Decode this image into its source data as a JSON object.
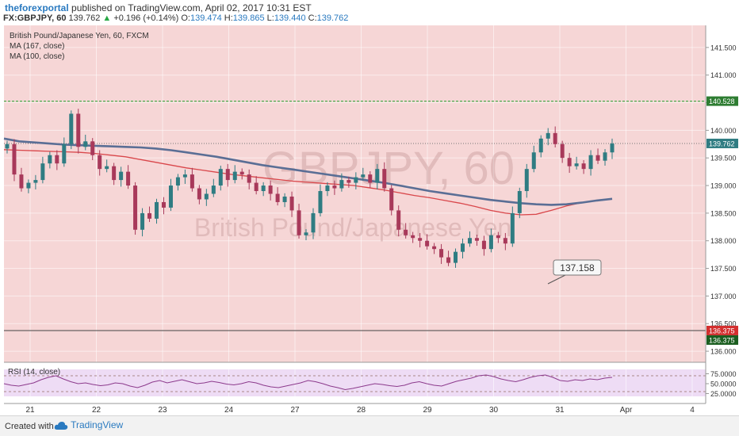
{
  "header": {
    "author": "theforexportal",
    "published": "published on TradingView.com, April 02, 2017 10:31 EST",
    "symbol": "FX:GBPJPY, 60",
    "last": "139.762",
    "change": "+0.196 (+0.14%)",
    "o_label": "O:",
    "o_val": "139.474",
    "h_label": "H:",
    "h_val": "139.865",
    "l_label": "L:",
    "l_val": "139.440",
    "c_label": "C:",
    "c_val": "139.762"
  },
  "legend": {
    "title": "British Pound/Japanese Yen, 60, FXCM",
    "ma1": "MA (167, close)",
    "ma2": "MA (100, close)"
  },
  "watermark": {
    "symbol": "GBPJPY, 60",
    "name": "British Pound/Japanese Yen"
  },
  "callout": "137.158",
  "footer": {
    "created": "Created with",
    "brand": "TradingView"
  },
  "colors": {
    "panel_bg": "#f6d6d6",
    "up_candle": "#2f7c82",
    "down_candle": "#a8395a",
    "ma167": "#5a6e95",
    "ma100": "#d9474b",
    "level_line": "#4caf50",
    "rsi_line": "#8c3a8c",
    "rsi_band": "#eedcf5"
  },
  "chart_data": {
    "type": "candlestick",
    "title": "British Pound/Japanese Yen, 60, FXCM",
    "y_axis": {
      "ticks": [
        "141.500",
        "141.000",
        "140.500",
        "140.000",
        "139.500",
        "139.000",
        "138.500",
        "138.000",
        "137.500",
        "137.000",
        "136.500",
        "136.000"
      ],
      "range": [
        135.8,
        141.9
      ]
    },
    "x_axis": {
      "ticks": [
        "21",
        "22",
        "23",
        "24",
        "27",
        "28",
        "29",
        "30",
        "31",
        "Apr",
        "4"
      ]
    },
    "price_labels": [
      "140.528",
      "139.762",
      "136.375",
      "136.375"
    ],
    "levels": {
      "resistance": 140.528,
      "last_price": 139.762,
      "support": 136.375
    },
    "annotation": {
      "text": "137.158",
      "value": 137.158
    },
    "closes": [
      139.75,
      139.2,
      138.95,
      139.05,
      139.1,
      139.4,
      139.55,
      139.4,
      139.75,
      140.3,
      139.7,
      139.8,
      139.55,
      139.3,
      139.35,
      139.1,
      139.25,
      139.0,
      138.2,
      138.5,
      138.4,
      138.7,
      138.6,
      139.0,
      139.15,
      139.2,
      138.95,
      138.75,
      138.85,
      139.0,
      139.3,
      139.1,
      139.25,
      139.2,
      139.05,
      138.9,
      139.0,
      138.85,
      138.7,
      138.8,
      138.55,
      138.1,
      138.15,
      138.5,
      138.9,
      139.0,
      138.95,
      139.1,
      139.05,
      139.15,
      139.2,
      139.05,
      139.3,
      138.95,
      138.55,
      138.2,
      138.1,
      138.05,
      138.0,
      137.9,
      137.85,
      137.7,
      137.6,
      137.8,
      137.95,
      138.05,
      138.0,
      137.85,
      138.1,
      138.05,
      137.95,
      138.5,
      138.9,
      139.3,
      139.6,
      139.85,
      139.95,
      139.75,
      139.5,
      139.35,
      139.4,
      139.3,
      139.55,
      139.45,
      139.6,
      139.76
    ],
    "ma_167": [
      139.85,
      139.8,
      139.78,
      139.76,
      139.74,
      139.73,
      139.72,
      139.71,
      139.7,
      139.69,
      139.67,
      139.64,
      139.6,
      139.56,
      139.52,
      139.47,
      139.42,
      139.37,
      139.33,
      139.29,
      139.25,
      139.21,
      139.17,
      139.13,
      139.09,
      139.05,
      139.0,
      138.95,
      138.9,
      138.86,
      138.82,
      138.78,
      138.74,
      138.71,
      138.68,
      138.66,
      138.65,
      138.66,
      138.69,
      138.73,
      138.76
    ],
    "ma_100": [
      139.65,
      139.64,
      139.63,
      139.62,
      139.61,
      139.6,
      139.58,
      139.55,
      139.52,
      139.47,
      139.42,
      139.37,
      139.32,
      139.28,
      139.24,
      139.2,
      139.17,
      139.14,
      139.11,
      139.08,
      139.06,
      139.04,
      139.02,
      139.0,
      138.96,
      138.92,
      138.87,
      138.82,
      138.78,
      138.73,
      138.68,
      138.62,
      138.55,
      138.5,
      138.47,
      138.48,
      138.55,
      138.63,
      138.69,
      138.73,
      138.76
    ],
    "rsi": {
      "label": "RSI (14, close)",
      "ticks": [
        "75.0000",
        "50.0000",
        "25.0000"
      ],
      "upper": 70,
      "lower": 30,
      "values": [
        50,
        46,
        44,
        48,
        52,
        60,
        66,
        70,
        62,
        55,
        50,
        52,
        48,
        45,
        47,
        52,
        50,
        44,
        40,
        46,
        54,
        58,
        52,
        56,
        60,
        55,
        50,
        52,
        56,
        53,
        49,
        47,
        50,
        55,
        52,
        46,
        42,
        40,
        44,
        48,
        52,
        58,
        55,
        50,
        44,
        40,
        35,
        38,
        42,
        46,
        50,
        48,
        45,
        43,
        46,
        52,
        55,
        50,
        46,
        44,
        50,
        56,
        60,
        64,
        70,
        72,
        68,
        62,
        58,
        55,
        60,
        66,
        70,
        72,
        66,
        58,
        56,
        60,
        58,
        62,
        60,
        64,
        66
      ]
    }
  }
}
